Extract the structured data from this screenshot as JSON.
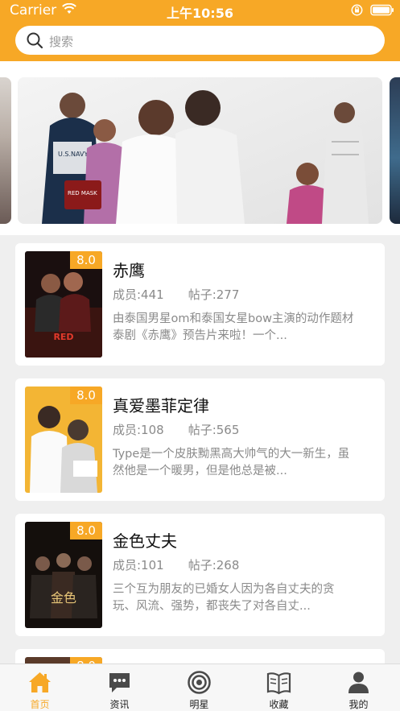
{
  "status_bar": {
    "carrier": "Carrier",
    "time": "上午10:56"
  },
  "search": {
    "placeholder": "搜索",
    "icon": "search-icon"
  },
  "banner": {
    "slides_visible": 3,
    "active_index": 0
  },
  "posts": [
    {
      "rating": "8.0",
      "title": "赤鹰",
      "members": "成员:441",
      "posts": "帖子:277",
      "description": "由泰国男星om和泰国女星bow主演的动作题材泰剧《赤鹰》预告片来啦！一个..."
    },
    {
      "rating": "8.0",
      "title": "真爱墨菲定律",
      "members": "成员:108",
      "posts": "帖子:565",
      "description": "Type是一个皮肤黝黑高大帅气的大一新生，虽然他是一个暖男，但是他总是被..."
    },
    {
      "rating": "8.0",
      "title": "金色丈夫",
      "members": "成员:101",
      "posts": "帖子:268",
      "description": "三个互为朋友的已婚女人因为各自丈夫的贪玩、风流、强势，都丧失了对各自丈..."
    },
    {
      "rating": "8.0"
    }
  ],
  "tabbar": {
    "items": [
      {
        "label": "首页",
        "icon": "home-icon",
        "active": true
      },
      {
        "label": "资讯",
        "icon": "chat-bubble-icon",
        "active": false
      },
      {
        "label": "明星",
        "icon": "target-icon",
        "active": false
      },
      {
        "label": "收藏",
        "icon": "book-icon",
        "active": false
      },
      {
        "label": "我的",
        "icon": "person-icon",
        "active": false
      }
    ]
  },
  "colors": {
    "accent": "#f7a826",
    "background": "#efefef",
    "card": "#ffffff",
    "muted_text": "#8a8a8a"
  }
}
